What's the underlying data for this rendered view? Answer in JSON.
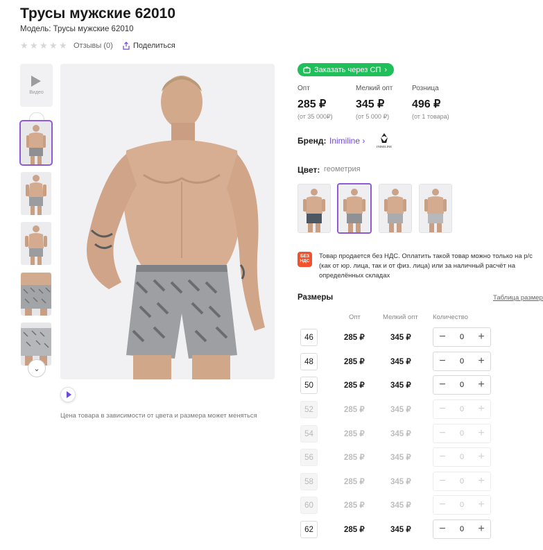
{
  "product": {
    "title": "Трусы мужские 62010",
    "model": "Модель: Трусы мужские 62010",
    "reviews": "Отзывы (0)",
    "share": "Поделиться"
  },
  "gallery": {
    "video_label": "Видео",
    "price_note": "Цена товара в зависимости от цвета и размера может меняться",
    "thumb_count": 5,
    "active_thumb": 1
  },
  "order": {
    "sp_button": "Заказать через СП"
  },
  "prices": [
    {
      "label": "Опт",
      "value": "285 ₽",
      "sub": "(от 35 000₽)"
    },
    {
      "label": "Мелкий опт",
      "value": "345 ₽",
      "sub": "(от 5 000 ₽)"
    },
    {
      "label": "Розница",
      "value": "496 ₽",
      "sub": "(от 1 товара)"
    }
  ],
  "brand": {
    "label": "Бренд:",
    "name": "Inimiline",
    "logo_text": "INIMILINE"
  },
  "color": {
    "label": "Цвет:",
    "value": "геометрия",
    "selected_index": 1
  },
  "vat": {
    "badge": "БЕЗ НДС",
    "text": "Товар продается без НДС. Оплатить такой товар можно только на р/с (как от юр. лица, так и от физ. лица) или за наличный расчёт на определённых складах"
  },
  "sizes": {
    "label": "Размеры",
    "table_link": "Таблица размеров",
    "headers": {
      "opt": "Опт",
      "small_opt": "Мелкий опт",
      "qty": "Количество"
    },
    "rows": [
      {
        "size": "46",
        "opt": "285 ₽",
        "small_opt": "345 ₽",
        "qty": "0",
        "available": true
      },
      {
        "size": "48",
        "opt": "285 ₽",
        "small_opt": "345 ₽",
        "qty": "0",
        "available": true
      },
      {
        "size": "50",
        "opt": "285 ₽",
        "small_opt": "345 ₽",
        "qty": "0",
        "available": true
      },
      {
        "size": "52",
        "opt": "285 ₽",
        "small_opt": "345 ₽",
        "qty": "0",
        "available": false
      },
      {
        "size": "54",
        "opt": "285 ₽",
        "small_opt": "345 ₽",
        "qty": "0",
        "available": false
      },
      {
        "size": "56",
        "opt": "285 ₽",
        "small_opt": "345 ₽",
        "qty": "0",
        "available": false
      },
      {
        "size": "58",
        "opt": "285 ₽",
        "small_opt": "345 ₽",
        "qty": "0",
        "available": false
      },
      {
        "size": "60",
        "opt": "285 ₽",
        "small_opt": "345 ₽",
        "qty": "0",
        "available": false
      },
      {
        "size": "62",
        "opt": "285 ₽",
        "small_opt": "345 ₽",
        "qty": "0",
        "available": true
      }
    ]
  },
  "colors": {
    "accent": "#8e5ad6",
    "sp_green": "#1fbf5a",
    "vat_badge": "#f0522d",
    "link": "#7047d8"
  }
}
